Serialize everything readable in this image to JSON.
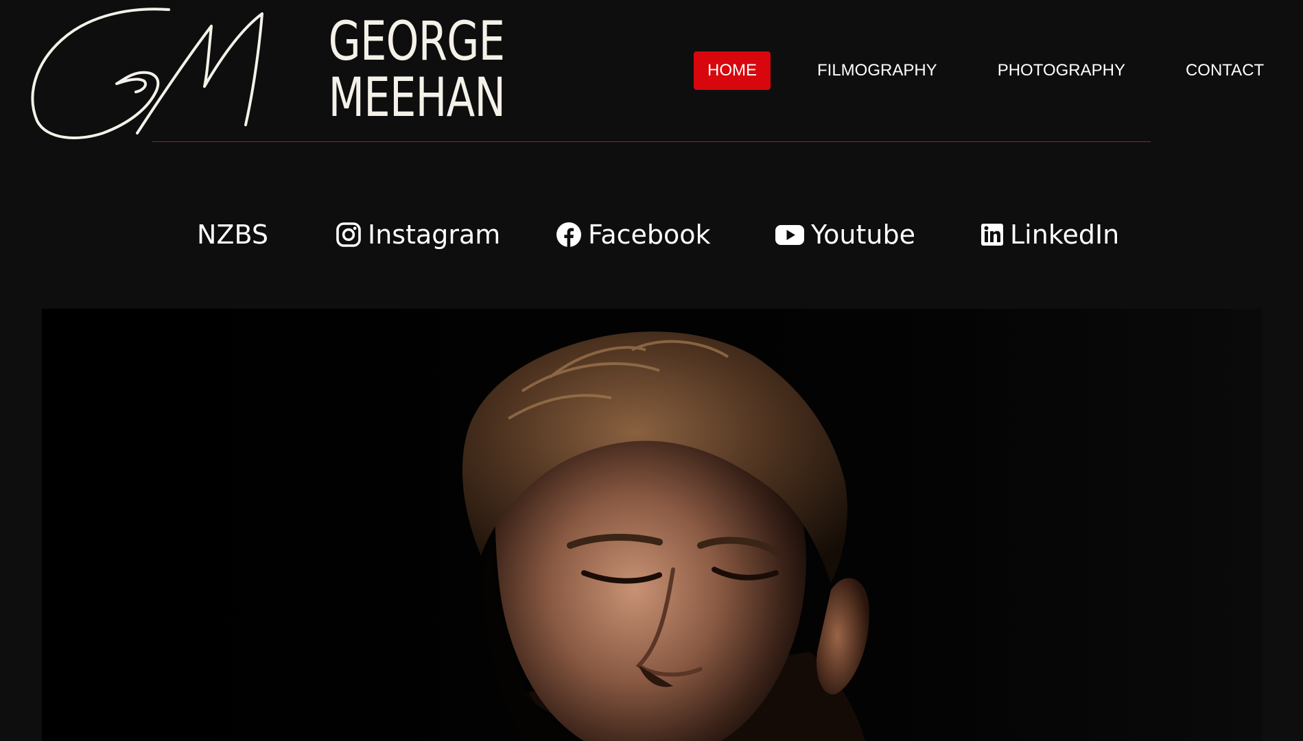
{
  "brand": {
    "monogram": "GM",
    "first_name": "GEORGE",
    "last_name": "MEEHAN"
  },
  "nav": {
    "items": [
      {
        "label": "HOME",
        "active": true
      },
      {
        "label": "FILMOGRAPHY",
        "active": false
      },
      {
        "label": "PHOTOGRAPHY",
        "active": false
      },
      {
        "label": "CONTACT",
        "active": false
      }
    ]
  },
  "social": {
    "links": [
      {
        "label": "NZBS",
        "icon": null
      },
      {
        "label": "Instagram",
        "icon": "instagram-icon"
      },
      {
        "label": "Facebook",
        "icon": "facebook-icon"
      },
      {
        "label": "Youtube",
        "icon": "youtube-icon"
      },
      {
        "label": "LinkedIn",
        "icon": "linkedin-icon"
      }
    ]
  },
  "colors": {
    "background": "#0e0e0e",
    "accent": "#d8070d",
    "text": "#ffffff",
    "logo": "#f4f1e8"
  },
  "hero": {
    "subject": "portrait-photo"
  }
}
